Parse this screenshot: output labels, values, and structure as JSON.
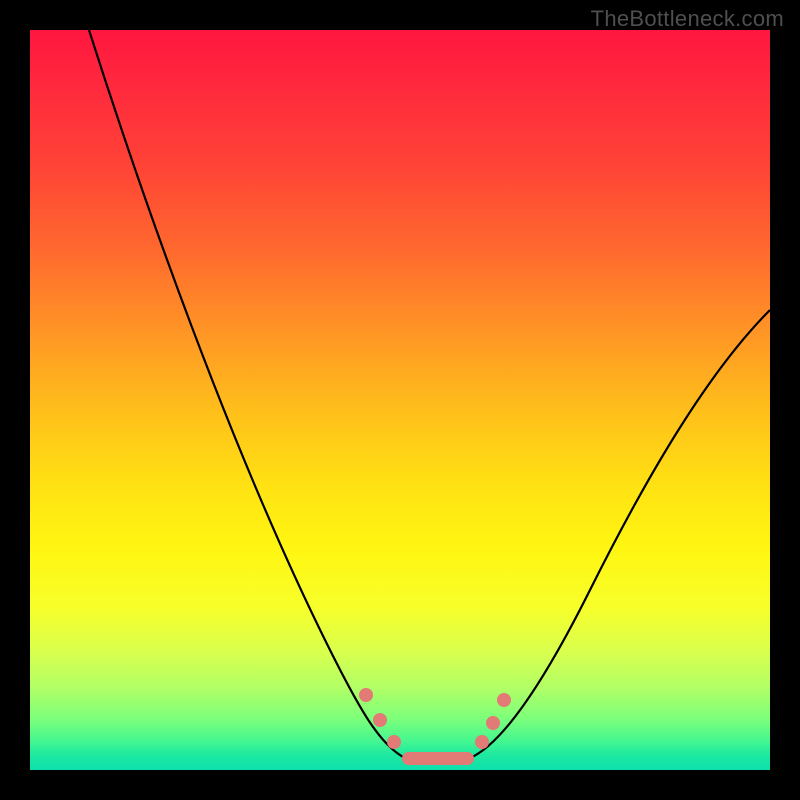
{
  "watermark": "TheBottleneck.com",
  "chart_data": {
    "type": "line",
    "title": "",
    "xlabel": "",
    "ylabel": "",
    "xlim": [
      0,
      100
    ],
    "ylim": [
      0,
      100
    ],
    "series": [
      {
        "name": "curve",
        "x": [
          8,
          12,
          16,
          20,
          24,
          28,
          32,
          36,
          40,
          42,
          44,
          46,
          48,
          50,
          52,
          54,
          56,
          58,
          60,
          62,
          66,
          70,
          74,
          78,
          82,
          86,
          90,
          94,
          98
        ],
        "y": [
          100,
          91,
          82,
          73,
          64,
          55,
          46,
          37,
          28,
          23,
          18,
          13,
          8,
          4,
          2,
          1,
          1,
          1,
          2,
          4,
          9,
          15,
          22,
          29,
          36,
          43,
          50,
          56,
          62
        ]
      }
    ],
    "markers": {
      "name": "highlight-dots",
      "color": "#e27a75",
      "points": [
        {
          "x": 45.5,
          "y": 9.5
        },
        {
          "x": 47.5,
          "y": 6.0
        },
        {
          "x": 49.5,
          "y": 3.0
        },
        {
          "x": 60.5,
          "y": 3.0
        },
        {
          "x": 62.0,
          "y": 5.5
        },
        {
          "x": 63.5,
          "y": 8.5
        }
      ]
    },
    "plateau": {
      "name": "plateau-bar",
      "color": "#e27a75",
      "x_start": 50,
      "x_end": 60,
      "y": 1.2
    }
  }
}
